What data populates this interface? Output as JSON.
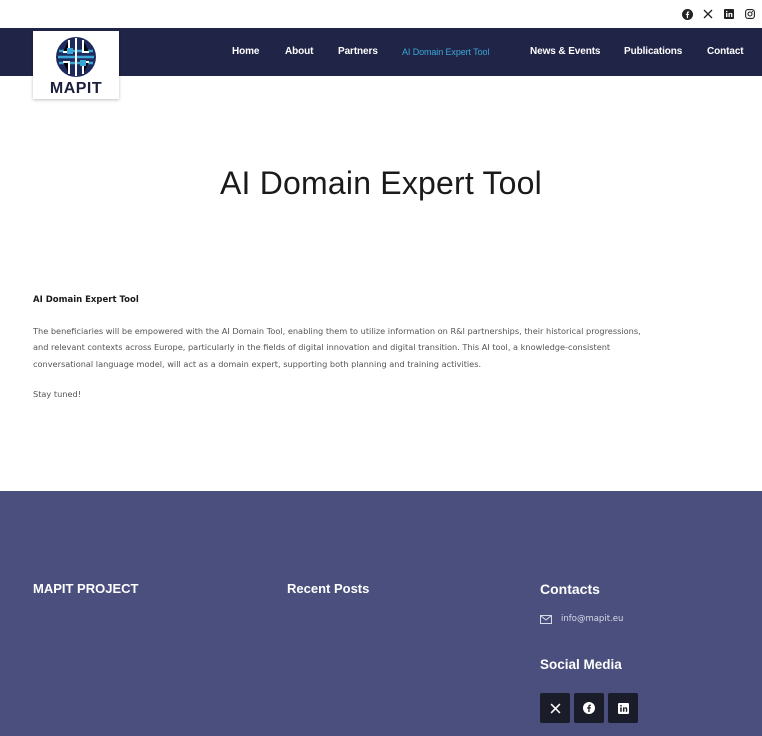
{
  "brand": {
    "logo_text": "MAPIT"
  },
  "topbar_icons": [
    "facebook-icon",
    "x-icon",
    "linkedin-icon",
    "instagram-icon"
  ],
  "nav": {
    "items": [
      {
        "label": "Home",
        "active": false
      },
      {
        "label": "About",
        "active": false
      },
      {
        "label": "Partners",
        "active": false
      },
      {
        "label": "AI Domain Expert Tool",
        "active": true
      },
      {
        "label": "News & Events",
        "active": false
      },
      {
        "label": "Publications",
        "active": false
      },
      {
        "label": "Contact",
        "active": false
      }
    ]
  },
  "page": {
    "title": "AI Domain Expert Tool",
    "subheading": "AI Domain Expert Tool",
    "paragraph_lines": [
      "The beneficiaries will be empowered with the AI Domain Tool, enabling them to utilize information on R&I partnerships, their historical progressions,",
      "and relevant contexts across Europe, particularly in the fields of digital innovation and digital transition. This AI tool, a knowledge-consistent",
      "conversational language model, will act as a domain expert, supporting both planning and training activities."
    ],
    "closing": "Stay tuned!"
  },
  "footer": {
    "col1_title": "MAPIT PROJECT",
    "col2_title": "Recent Posts",
    "col3_title": "Contacts",
    "email": "info@mapit.eu",
    "social_title": "Social Media",
    "social_icons": [
      "x-icon",
      "facebook-icon",
      "linkedin-icon"
    ]
  },
  "colors": {
    "nav_bg": "#202447",
    "active_link": "#3aa7d6",
    "footer_bg": "#4a4f7d",
    "social_btn": "#1b1c2a"
  }
}
